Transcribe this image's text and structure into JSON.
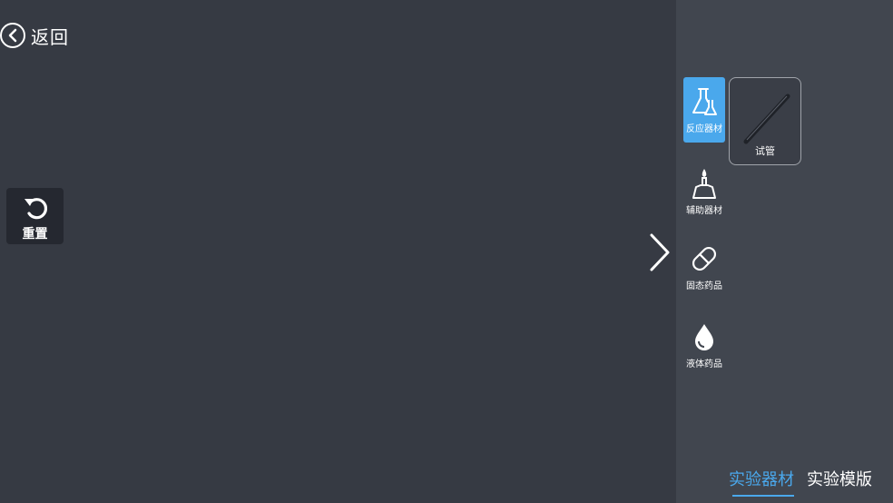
{
  "back": {
    "label": "返回",
    "icon": "chevron-left-circle-icon"
  },
  "reset": {
    "label": "重置",
    "icon": "rotate-ccw-icon"
  },
  "expand": {
    "icon": "chevron-right-icon"
  },
  "sidebar": {
    "categories": [
      {
        "label": "反应器材",
        "icon": "flask-icon",
        "active": true
      },
      {
        "label": "辅助器材",
        "icon": "alcohol-lamp-icon",
        "active": false
      },
      {
        "label": "固态药品",
        "icon": "pill-icon",
        "active": false
      },
      {
        "label": "液体药品",
        "icon": "droplet-icon",
        "active": false
      }
    ],
    "items": [
      {
        "label": "试管",
        "icon": "test-tube-icon"
      }
    ]
  },
  "tabs": [
    {
      "label": "实验器材",
      "active": true
    },
    {
      "label": "实验模版",
      "active": false
    }
  ],
  "colors": {
    "accent": "#4aa8ec",
    "background": "#363a43",
    "panel": "#41464f"
  }
}
